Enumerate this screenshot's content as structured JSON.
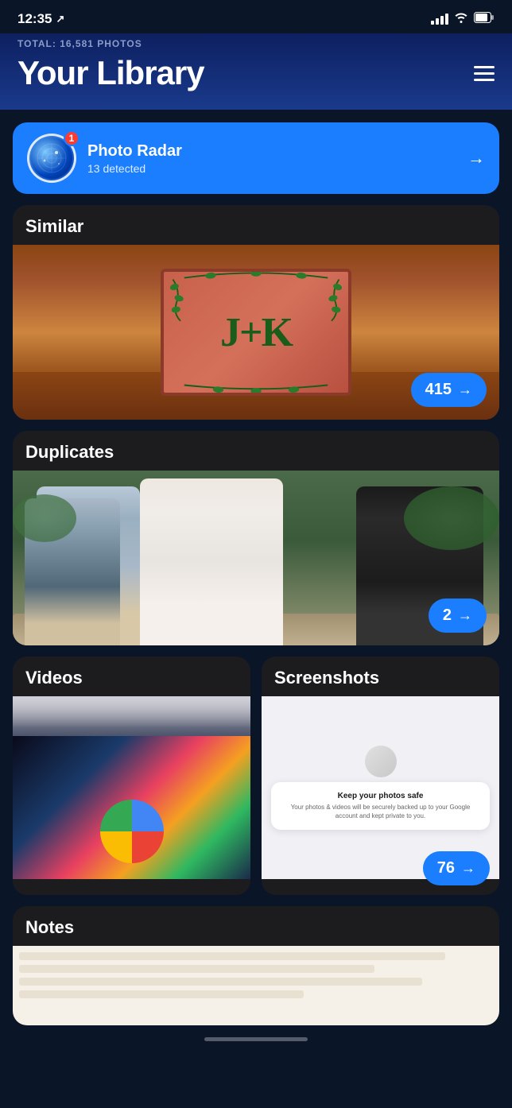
{
  "statusBar": {
    "time": "12:35",
    "locationArrow": "↗"
  },
  "header": {
    "totalLabel": "TOTAL: 16,581 PHOTOS",
    "title": "Your Library",
    "menuIcon": "menu"
  },
  "radar": {
    "badge": "1",
    "title": "Photo Radar",
    "subtitle": "13 detected",
    "arrow": "→"
  },
  "similar": {
    "label": "Similar",
    "count": "415",
    "arrow": "→"
  },
  "duplicates": {
    "label": "Duplicates",
    "count": "2",
    "arrow": "→"
  },
  "videos": {
    "label": "Videos"
  },
  "screenshots": {
    "label": "Screenshots",
    "count": "76",
    "arrow": "→",
    "mockTitle": "Keep your photos safe",
    "mockBody": "Your photos & videos will be securely backed up to your Google account and kept private to you."
  },
  "notes": {
    "label": "Notes"
  }
}
